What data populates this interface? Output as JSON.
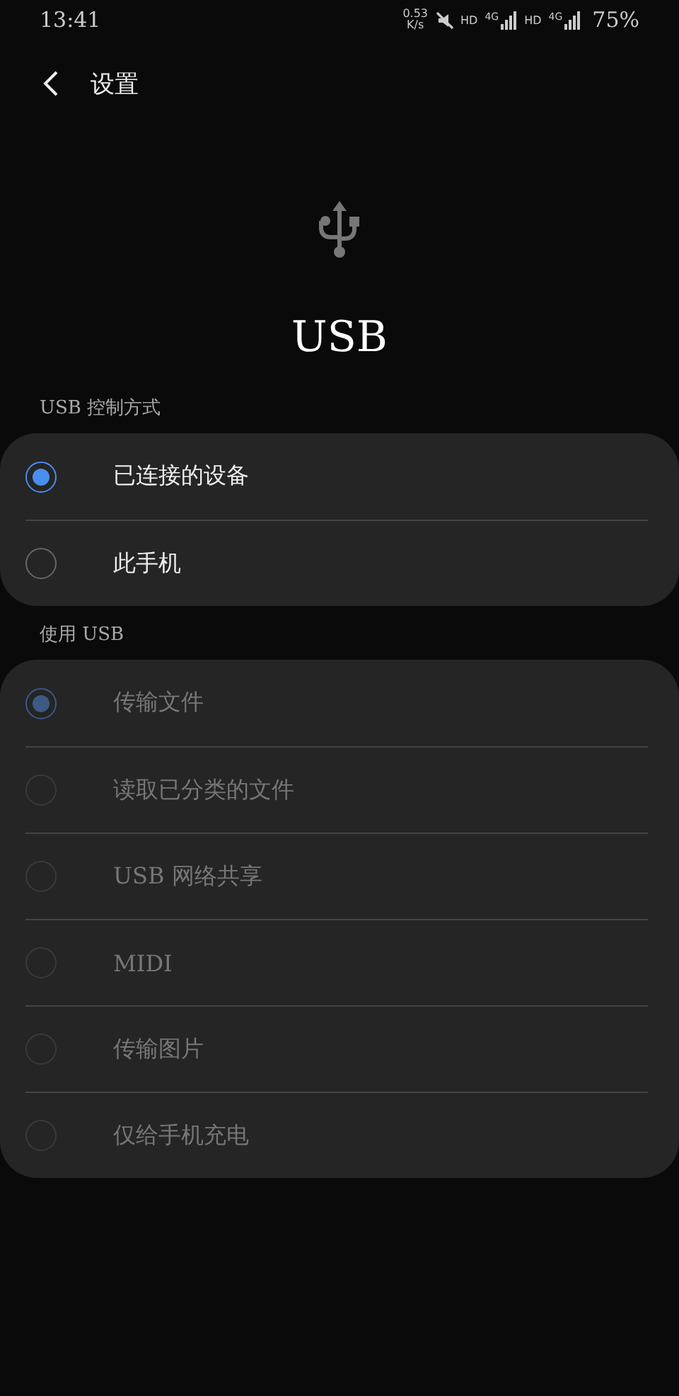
{
  "status_bar": {
    "time": "13:41",
    "speed_value": "0.53",
    "speed_unit": "K/s",
    "indicators": [
      {
        "kind": "mute"
      },
      {
        "kind": "label",
        "text": "HD"
      },
      {
        "kind": "net",
        "text": "4G"
      },
      {
        "kind": "label",
        "text": "HD"
      },
      {
        "kind": "net",
        "text": "4G"
      }
    ],
    "battery": "75%"
  },
  "header": {
    "back_title": "设置"
  },
  "title": "USB",
  "sections": [
    {
      "label": "USB 控制方式",
      "disabled": false,
      "options": [
        {
          "label": "已连接的设备",
          "selected": true
        },
        {
          "label": "此手机",
          "selected": false
        }
      ]
    },
    {
      "label": "使用 USB",
      "disabled": true,
      "options": [
        {
          "label": "传输文件",
          "selected": true
        },
        {
          "label": "读取已分类的文件",
          "selected": false
        },
        {
          "label": "USB 网络共享",
          "selected": false
        },
        {
          "label": "MIDI",
          "selected": false
        },
        {
          "label": "传输图片",
          "selected": false
        },
        {
          "label": "仅给手机充电",
          "selected": false
        }
      ]
    }
  ]
}
